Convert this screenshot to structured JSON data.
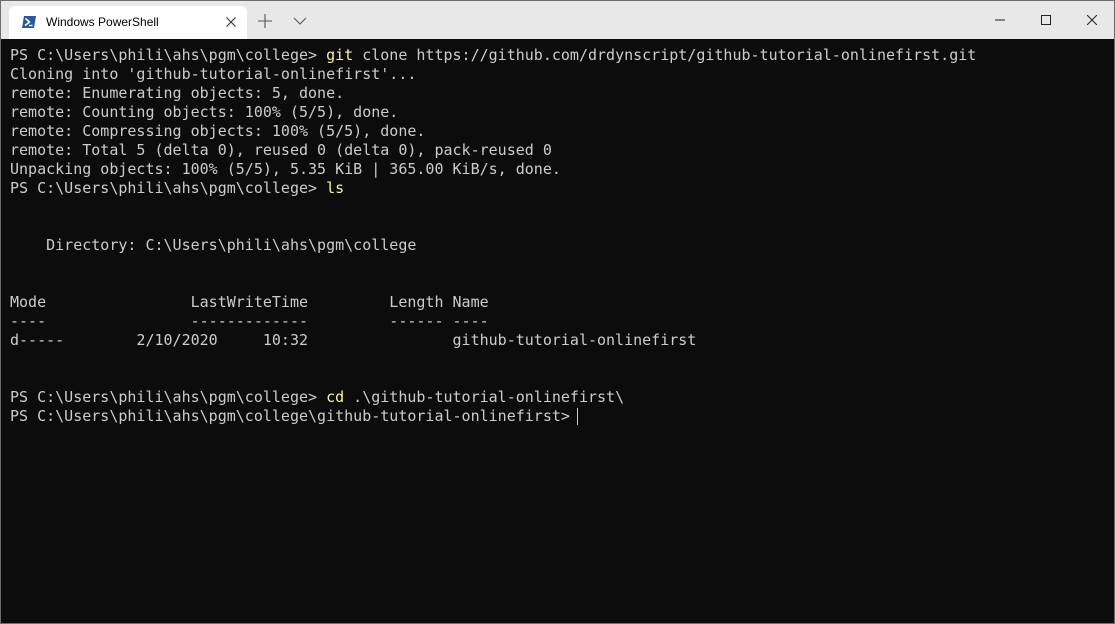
{
  "window": {
    "tab_title": "Windows PowerShell",
    "icons": {
      "tab": "powershell-icon",
      "close_tab": "close-icon",
      "new_tab": "plus-icon",
      "dropdown": "chevron-down-icon",
      "minimize": "minimize-icon",
      "maximize": "maximize-icon",
      "close": "close-icon"
    }
  },
  "colors": {
    "background": "#0c0c0c",
    "foreground": "#cccccc",
    "command": "#f9f1a5",
    "titlebar": "#e8e8e8"
  },
  "terminal": {
    "lines": [
      {
        "prompt": "PS C:\\Users\\phili\\ahs\\pgm\\college> ",
        "cmd": "git",
        "rest": " clone https://github.com/drdynscript/github-tutorial-onlinefirst.git"
      },
      {
        "text": "Cloning into 'github-tutorial-onlinefirst'..."
      },
      {
        "text": "remote: Enumerating objects: 5, done."
      },
      {
        "text": "remote: Counting objects: 100% (5/5), done."
      },
      {
        "text": "remote: Compressing objects: 100% (5/5), done."
      },
      {
        "text": "remote: Total 5 (delta 0), reused 0 (delta 0), pack-reused 0"
      },
      {
        "text": "Unpacking objects: 100% (5/5), 5.35 KiB | 365.00 KiB/s, done."
      },
      {
        "prompt": "PS C:\\Users\\phili\\ahs\\pgm\\college> ",
        "cmd": "ls",
        "rest": ""
      },
      {
        "text": ""
      },
      {
        "text": ""
      },
      {
        "text": "    Directory: C:\\Users\\phili\\ahs\\pgm\\college"
      },
      {
        "text": ""
      },
      {
        "text": ""
      },
      {
        "text": "Mode                LastWriteTime         Length Name"
      },
      {
        "text": "----                -------------         ------ ----"
      },
      {
        "text": "d-----        2/10/2020     10:32                github-tutorial-onlinefirst"
      },
      {
        "text": ""
      },
      {
        "text": ""
      },
      {
        "prompt": "PS C:\\Users\\phili\\ahs\\pgm\\college> ",
        "cmd": "cd",
        "rest": " .\\github-tutorial-onlinefirst\\"
      },
      {
        "prompt": "PS C:\\Users\\phili\\ahs\\pgm\\college\\github-tutorial-onlinefirst> ",
        "cmd": "",
        "rest": ""
      }
    ]
  }
}
